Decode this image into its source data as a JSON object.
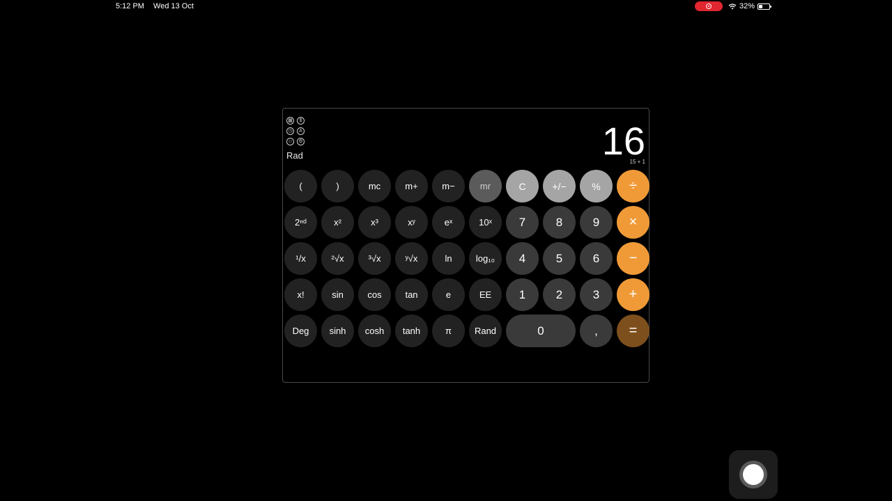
{
  "status_bar": {
    "time": "5:12 PM",
    "date": "Wed 13 Oct",
    "battery_percent": "32%",
    "battery_level": 0.32,
    "recording": true
  },
  "calculator": {
    "mode_icons": [
      "grid-icon",
      "dollar-icon",
      "clock-icon",
      "text-icon",
      "mask-icon",
      "tools-icon"
    ],
    "angle_mode": "Rad",
    "display": "16",
    "expression": "15 + 1",
    "keys": [
      {
        "label": "(",
        "kind": "fn",
        "name": "open-paren-key"
      },
      {
        "label": ")",
        "kind": "fn",
        "name": "close-paren-key"
      },
      {
        "label": "mc",
        "kind": "fn",
        "name": "mc-key"
      },
      {
        "label": "m+",
        "kind": "fn",
        "name": "m-plus-key"
      },
      {
        "label": "m−",
        "kind": "fn",
        "name": "m-minus-key"
      },
      {
        "label": "mr",
        "kind": "mem-on",
        "name": "mr-key"
      },
      {
        "label": "C",
        "kind": "util",
        "name": "clear-key"
      },
      {
        "label": "+/−",
        "kind": "util",
        "name": "sign-toggle-key"
      },
      {
        "label": "%",
        "kind": "util",
        "name": "percent-key"
      },
      {
        "label": "÷",
        "kind": "op",
        "name": "divide-key"
      },
      {
        "label": "2ⁿᵈ",
        "kind": "fn",
        "name": "second-key"
      },
      {
        "label": "x²",
        "kind": "fn",
        "name": "square-key"
      },
      {
        "label": "x³",
        "kind": "fn",
        "name": "cube-key"
      },
      {
        "label": "xʸ",
        "kind": "fn",
        "name": "power-key"
      },
      {
        "label": "eˣ",
        "kind": "fn",
        "name": "exp-key"
      },
      {
        "label": "10ˣ",
        "kind": "fn",
        "name": "ten-power-key"
      },
      {
        "label": "7",
        "kind": "num",
        "name": "digit-7-key"
      },
      {
        "label": "8",
        "kind": "num",
        "name": "digit-8-key"
      },
      {
        "label": "9",
        "kind": "num",
        "name": "digit-9-key"
      },
      {
        "label": "×",
        "kind": "op",
        "name": "multiply-key"
      },
      {
        "label": "¹/x",
        "kind": "fn",
        "name": "reciprocal-key"
      },
      {
        "label": "²√x",
        "kind": "fn",
        "name": "sqrt-key"
      },
      {
        "label": "³√x",
        "kind": "fn",
        "name": "cbrt-key"
      },
      {
        "label": "ʸ√x",
        "kind": "fn",
        "name": "yroot-key"
      },
      {
        "label": "ln",
        "kind": "fn",
        "name": "ln-key"
      },
      {
        "label": "log₁₀",
        "kind": "fn",
        "name": "log10-key"
      },
      {
        "label": "4",
        "kind": "num",
        "name": "digit-4-key"
      },
      {
        "label": "5",
        "kind": "num",
        "name": "digit-5-key"
      },
      {
        "label": "6",
        "kind": "num",
        "name": "digit-6-key"
      },
      {
        "label": "−",
        "kind": "op",
        "name": "subtract-key"
      },
      {
        "label": "x!",
        "kind": "fn",
        "name": "factorial-key"
      },
      {
        "label": "sin",
        "kind": "fn",
        "name": "sin-key"
      },
      {
        "label": "cos",
        "kind": "fn",
        "name": "cos-key"
      },
      {
        "label": "tan",
        "kind": "fn",
        "name": "tan-key"
      },
      {
        "label": "e",
        "kind": "fn",
        "name": "e-key"
      },
      {
        "label": "EE",
        "kind": "fn",
        "name": "ee-key"
      },
      {
        "label": "1",
        "kind": "num",
        "name": "digit-1-key"
      },
      {
        "label": "2",
        "kind": "num",
        "name": "digit-2-key"
      },
      {
        "label": "3",
        "kind": "num",
        "name": "digit-3-key"
      },
      {
        "label": "+",
        "kind": "op",
        "name": "add-key"
      },
      {
        "label": "Deg",
        "kind": "fn",
        "name": "deg-key"
      },
      {
        "label": "sinh",
        "kind": "fn",
        "name": "sinh-key"
      },
      {
        "label": "cosh",
        "kind": "fn",
        "name": "cosh-key"
      },
      {
        "label": "tanh",
        "kind": "fn",
        "name": "tanh-key"
      },
      {
        "label": "π",
        "kind": "fn",
        "name": "pi-key"
      },
      {
        "label": "Rand",
        "kind": "fn",
        "name": "rand-key"
      },
      {
        "label": "0",
        "kind": "num wide",
        "name": "digit-0-key"
      },
      {
        "label": ",",
        "kind": "num",
        "name": "decimal-key"
      },
      {
        "label": "=",
        "kind": "op-active",
        "name": "equals-key"
      }
    ]
  },
  "colors": {
    "operator": "#f09a37",
    "operator_active": "#7d4f1d",
    "utility": "#a5a5a5",
    "number": "#3a3a3a",
    "function": "#222222",
    "record": "#e0262f"
  }
}
